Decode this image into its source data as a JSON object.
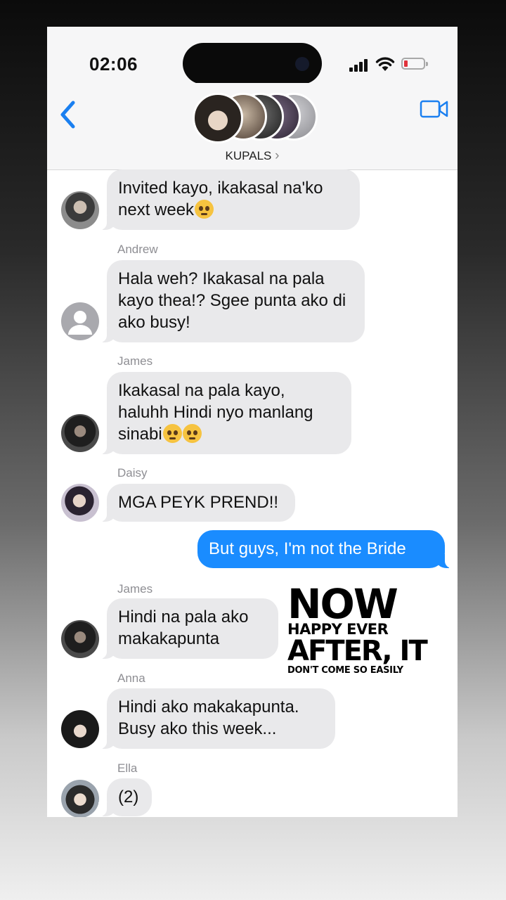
{
  "status": {
    "time": "02:06"
  },
  "conversation": {
    "title": "KUPALS",
    "title_chevron": "›"
  },
  "messages": [
    {
      "sender": "",
      "text": "Invited kayo, ikakasal na'ko next week",
      "emoji": "pleading-face"
    },
    {
      "sender": "Andrew",
      "text": "Hala weh? Ikakasal na pala kayo thea!? Sgee punta ako di ako busy!"
    },
    {
      "sender": "James",
      "text": "Ikakasal na pala kayo, haluhh Hindi nyo manlang sinabi",
      "emoji": "eye-roll-and-pleading-face"
    },
    {
      "sender": "Daisy",
      "text": "MGA PEYK PREND!!"
    },
    {
      "sender": "me",
      "text": "But guys, I'm not the Bride"
    },
    {
      "sender": "James",
      "text": "Hindi na pala ako makakapunta"
    },
    {
      "sender": "Anna",
      "text": "Hindi ako makakapunta. Busy ako this week..."
    },
    {
      "sender": "Ella",
      "text": "(2)"
    }
  ],
  "overlay": {
    "line1": "NOW",
    "line2": "HAPPY EVER",
    "line3": "AFTER, IT",
    "line4": "DON'T COME SO EASILY"
  },
  "colors": {
    "accent": "#1a8cff",
    "bubble_gray": "#e9e9eb",
    "battery_low": "#e0323b"
  },
  "icons": [
    "back-chevron-icon",
    "video-call-icon",
    "signal-icon",
    "wifi-icon",
    "battery-icon",
    "default-avatar-icon"
  ]
}
